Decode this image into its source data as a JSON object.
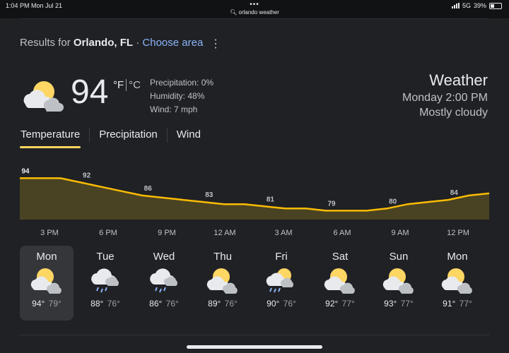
{
  "status_bar": {
    "time": "1:04 PM",
    "date": "Mon Jul 21",
    "dots": "•••",
    "url": "orlando weather",
    "network": "5G",
    "battery": "39%"
  },
  "results": {
    "prefix": "Results for",
    "location": "Orlando, FL",
    "separator": "·",
    "choose_area": "Choose area"
  },
  "current": {
    "icon": "partly-cloudy-icon",
    "temperature": "94",
    "unit_f": "°F",
    "unit_c": "°C",
    "precipitation": "Precipitation: 0%",
    "humidity": "Humidity: 48%",
    "wind": "Wind: 7 mph"
  },
  "header": {
    "title": "Weather",
    "datetime": "Monday 2:00 PM",
    "condition": "Mostly cloudy"
  },
  "tabs": [
    "Temperature",
    "Precipitation",
    "Wind"
  ],
  "chart_data": {
    "type": "area",
    "x": [
      "3 PM",
      "4 PM",
      "5 PM",
      "6 PM",
      "7 PM",
      "8 PM",
      "9 PM",
      "10 PM",
      "11 PM",
      "12 AM",
      "1 AM",
      "2 AM",
      "3 AM",
      "4 AM",
      "5 AM",
      "6 AM",
      "7 AM",
      "8 AM",
      "9 AM",
      "10 AM",
      "11 AM",
      "12 PM",
      "1 PM",
      "2 PM"
    ],
    "values": [
      94,
      94,
      94,
      92,
      90,
      88,
      86,
      85,
      84,
      83,
      82,
      82,
      81,
      80,
      80,
      79,
      79,
      79,
      80,
      82,
      83,
      84,
      86,
      87
    ],
    "labels": [
      {
        "index": 0,
        "text": "94"
      },
      {
        "index": 3,
        "text": "92"
      },
      {
        "index": 6,
        "text": "86"
      },
      {
        "index": 9,
        "text": "83"
      },
      {
        "index": 12,
        "text": "81"
      },
      {
        "index": 15,
        "text": "79"
      },
      {
        "index": 18,
        "text": "80"
      },
      {
        "index": 21,
        "text": "84"
      }
    ],
    "tick_labels": [
      "3 PM",
      "6 PM",
      "9 PM",
      "12 AM",
      "3 AM",
      "6 AM",
      "9 AM",
      "12 PM"
    ],
    "line_color": "#fbbc04",
    "fill_color": "#4a4323"
  },
  "days": [
    {
      "name": "Mon",
      "icon": "partly-cloudy-icon",
      "hi": "94°",
      "lo": "79°"
    },
    {
      "name": "Tue",
      "icon": "rain-icon",
      "hi": "88°",
      "lo": "76°"
    },
    {
      "name": "Wed",
      "icon": "rain-icon",
      "hi": "86°",
      "lo": "76°"
    },
    {
      "name": "Thu",
      "icon": "partly-cloudy-icon",
      "hi": "89°",
      "lo": "76°"
    },
    {
      "name": "Fri",
      "icon": "sun-rain-icon",
      "hi": "90°",
      "lo": "76°"
    },
    {
      "name": "Sat",
      "icon": "partly-cloudy-icon",
      "hi": "92°",
      "lo": "77°"
    },
    {
      "name": "Sun",
      "icon": "partly-cloudy-icon",
      "hi": "93°",
      "lo": "77°"
    },
    {
      "name": "Mon",
      "icon": "partly-cloudy-icon",
      "hi": "91°",
      "lo": "77°"
    }
  ],
  "colors": {
    "background": "#202124",
    "accent": "#fdd663",
    "link": "#8ab4f8",
    "sun": "#fdd663",
    "cloud": "#e8eaed",
    "rain": "#8ab4f8"
  }
}
